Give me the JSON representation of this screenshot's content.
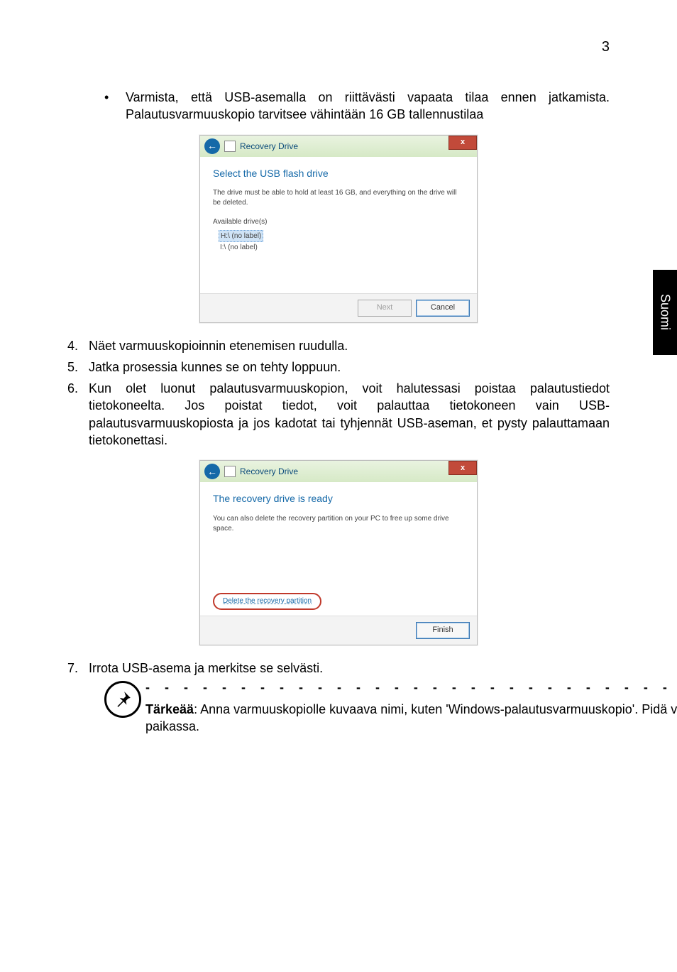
{
  "page_number": "3",
  "side_tab": "Suomi",
  "intro_bullet": {
    "marker": "•",
    "line1": "Varmista, että USB-asemalla on riittävästi vapaata tilaa ennen jatkamista.",
    "line2": "Palautusvarmuuskopio tarvitsee vähintään 16 GB tallennustilaa"
  },
  "dialog1": {
    "title": "Recovery Drive",
    "close": "x",
    "heading": "Select the USB flash drive",
    "sub": "The drive must be able to hold at least 16 GB, and everything on the drive will be deleted.",
    "list_label": "Available drive(s)",
    "item_sel": "H:\\ (no label)",
    "item2": "I:\\ (no label)",
    "btn_next": "Next",
    "btn_cancel": "Cancel"
  },
  "steps": {
    "s4": "Näet varmuuskopioinnin etenemisen ruudulla.",
    "s5": "Jatka prosessia kunnes se on tehty loppuun.",
    "s6": "Kun olet luonut palautusvarmuuskopion, voit halutessasi poistaa palautustiedot tietokoneelta. Jos poistat tiedot, voit palauttaa tietokoneen vain USB-palautusvarmuuskopiosta ja jos kadotat tai tyhjennät USB-aseman, et pysty palauttamaan tietokonettasi.",
    "s7": "Irrota USB-asema ja merkitse se selvästi."
  },
  "dialog2": {
    "title": "Recovery Drive",
    "close": "x",
    "heading": "The recovery drive is ready",
    "sub": "You can also delete the recovery partition on your PC to free up some drive space.",
    "delete_link": "Delete the recovery partition",
    "btn_finish": "Finish"
  },
  "note": {
    "label": "Tärkeää",
    "text": ": Anna varmuuskopiolle kuvaava nimi, kuten 'Windows-palautusvarmuuskopio'. Pidä varmuuskopiota varmassa ja helposti muistettavassa paikassa."
  }
}
